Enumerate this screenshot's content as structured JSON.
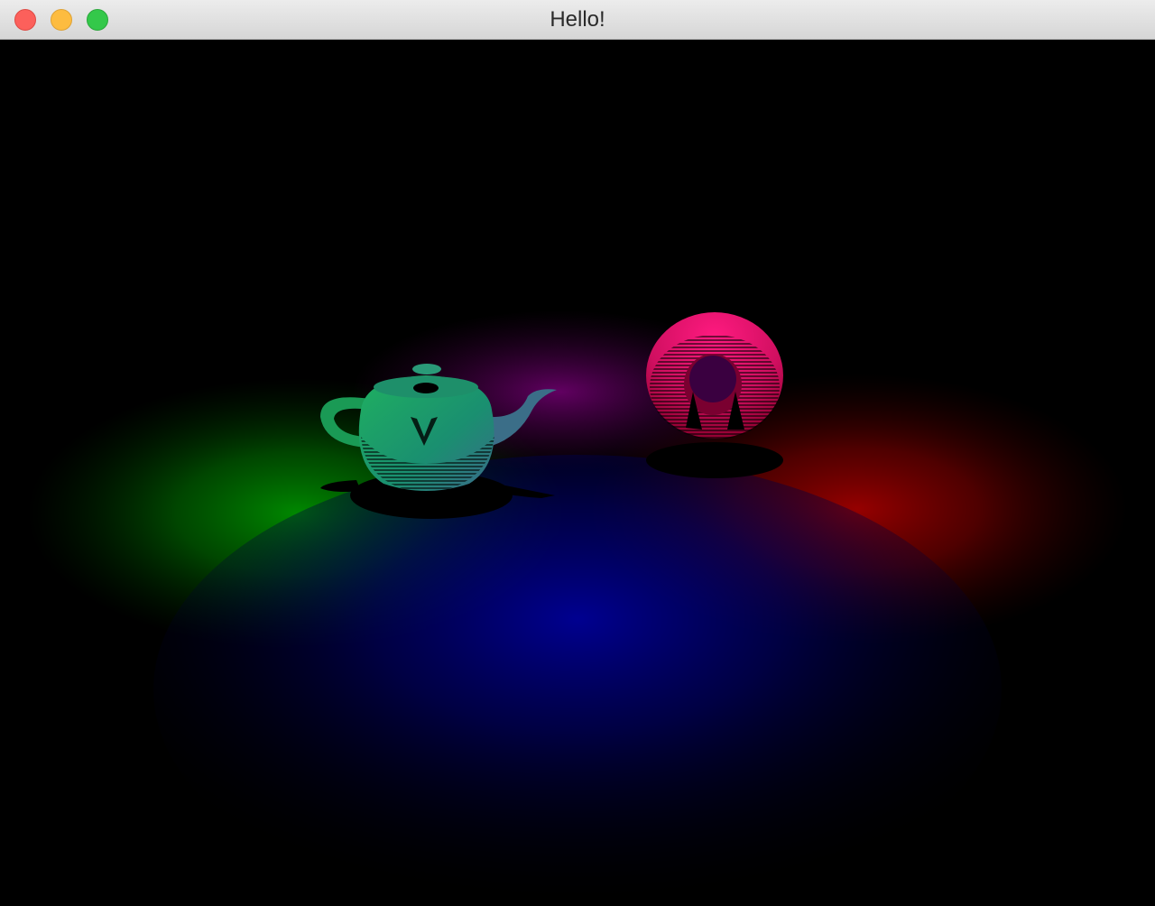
{
  "window": {
    "title": "Hello!",
    "buttons": [
      {
        "name": "close",
        "color": "#fc605b"
      },
      {
        "name": "minimize",
        "color": "#fdbc40"
      },
      {
        "name": "zoom",
        "color": "#34c84a"
      }
    ]
  },
  "scene": {
    "background": "#000000",
    "lights": [
      {
        "name": "green",
        "color": "#00ff00"
      },
      {
        "name": "red",
        "color": "#ff0000"
      },
      {
        "name": "blue",
        "color": "#0000ff"
      }
    ],
    "objects": [
      {
        "name": "teapot",
        "color": "#1fa06a"
      },
      {
        "name": "torus",
        "color": "#f0106e"
      }
    ]
  }
}
